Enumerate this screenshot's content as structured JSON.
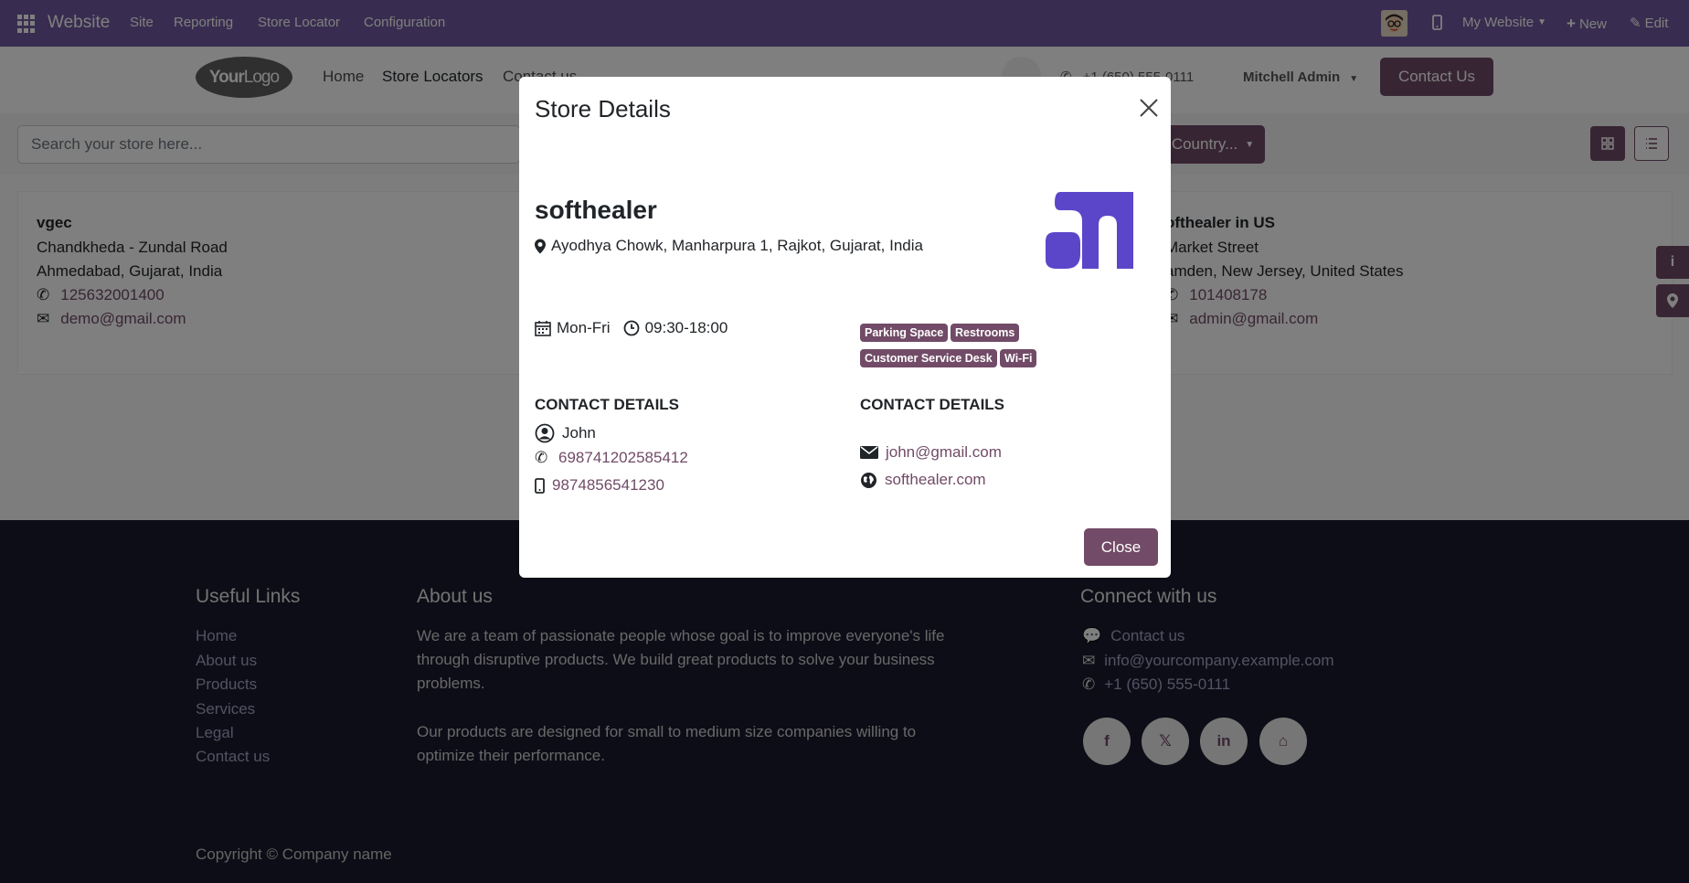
{
  "admin_bar": {
    "brand": "Website",
    "menu": [
      "Site",
      "Reporting",
      "Store Locator",
      "Configuration"
    ],
    "website_selector": "My Website",
    "new_label": "New",
    "edit_label": "Edit"
  },
  "site_header": {
    "logo_text_bold": "Your",
    "logo_text_light": "Logo",
    "nav": [
      "Home",
      "Store Locators",
      "Contact us"
    ],
    "phone": "+1 (650) 555-0111",
    "user": "Mitchell Admin",
    "contact_button": "Contact Us"
  },
  "store_search": {
    "placeholder": "Search your store here...",
    "country_button": "Country..."
  },
  "stores": [
    {
      "name": "vgec",
      "street": "Chandkheda - Zundal Road",
      "city": "Ahmedabad, Gujarat, India",
      "phone": "125632001400",
      "email": "demo@gmail.com"
    },
    {
      "name": "ofthealer in US",
      "street": "Market Street",
      "city": "amden, New Jersey, United States",
      "phone": "101408178",
      "email": "admin@gmail.com"
    }
  ],
  "modal": {
    "title": "Store Details",
    "store_name": "softhealer",
    "address": "Ayodhya Chowk, Manharpura 1, Rajkot, Gujarat, India",
    "days": "Mon-Fri",
    "hours": "09:30-18:00",
    "amenities": [
      "Parking Space",
      "Restrooms",
      "Customer Service Desk",
      "Wi-Fi"
    ],
    "contact_heading_left": "CONTACT DETAILS",
    "contact_heading_right": "CONTACT DETAILS",
    "contact_person": "John",
    "phone": "698741202585412",
    "mobile": "9874856541230",
    "email": "john@gmail.com",
    "website": "softhealer.com",
    "close_label": "Close",
    "accent_color": "#714b67",
    "logo_color": "#5b46c9"
  },
  "footer": {
    "useful_links_heading": "Useful Links",
    "useful_links": [
      "Home",
      "About us",
      "Products",
      "Services",
      "Legal",
      "Contact us"
    ],
    "about_heading": "About us",
    "about_p1": "We are a team of passionate people whose goal is to improve everyone's life through disruptive products. We build great products to solve your business problems.",
    "about_p2": "Our products are designed for small to medium size companies willing to optimize their performance.",
    "connect_heading": "Connect with us",
    "connect_contact": "Contact us",
    "connect_email": "info@yourcompany.example.com",
    "connect_phone": "+1 (650) 555-0111",
    "social": [
      "facebook-icon",
      "x-icon",
      "linkedin-icon",
      "home-icon"
    ],
    "copyright": "Copyright © Company name"
  },
  "colors": {
    "admin_bar": "#715aa0",
    "primary": "#714b67",
    "footer_bg": "#1a1a2e"
  }
}
